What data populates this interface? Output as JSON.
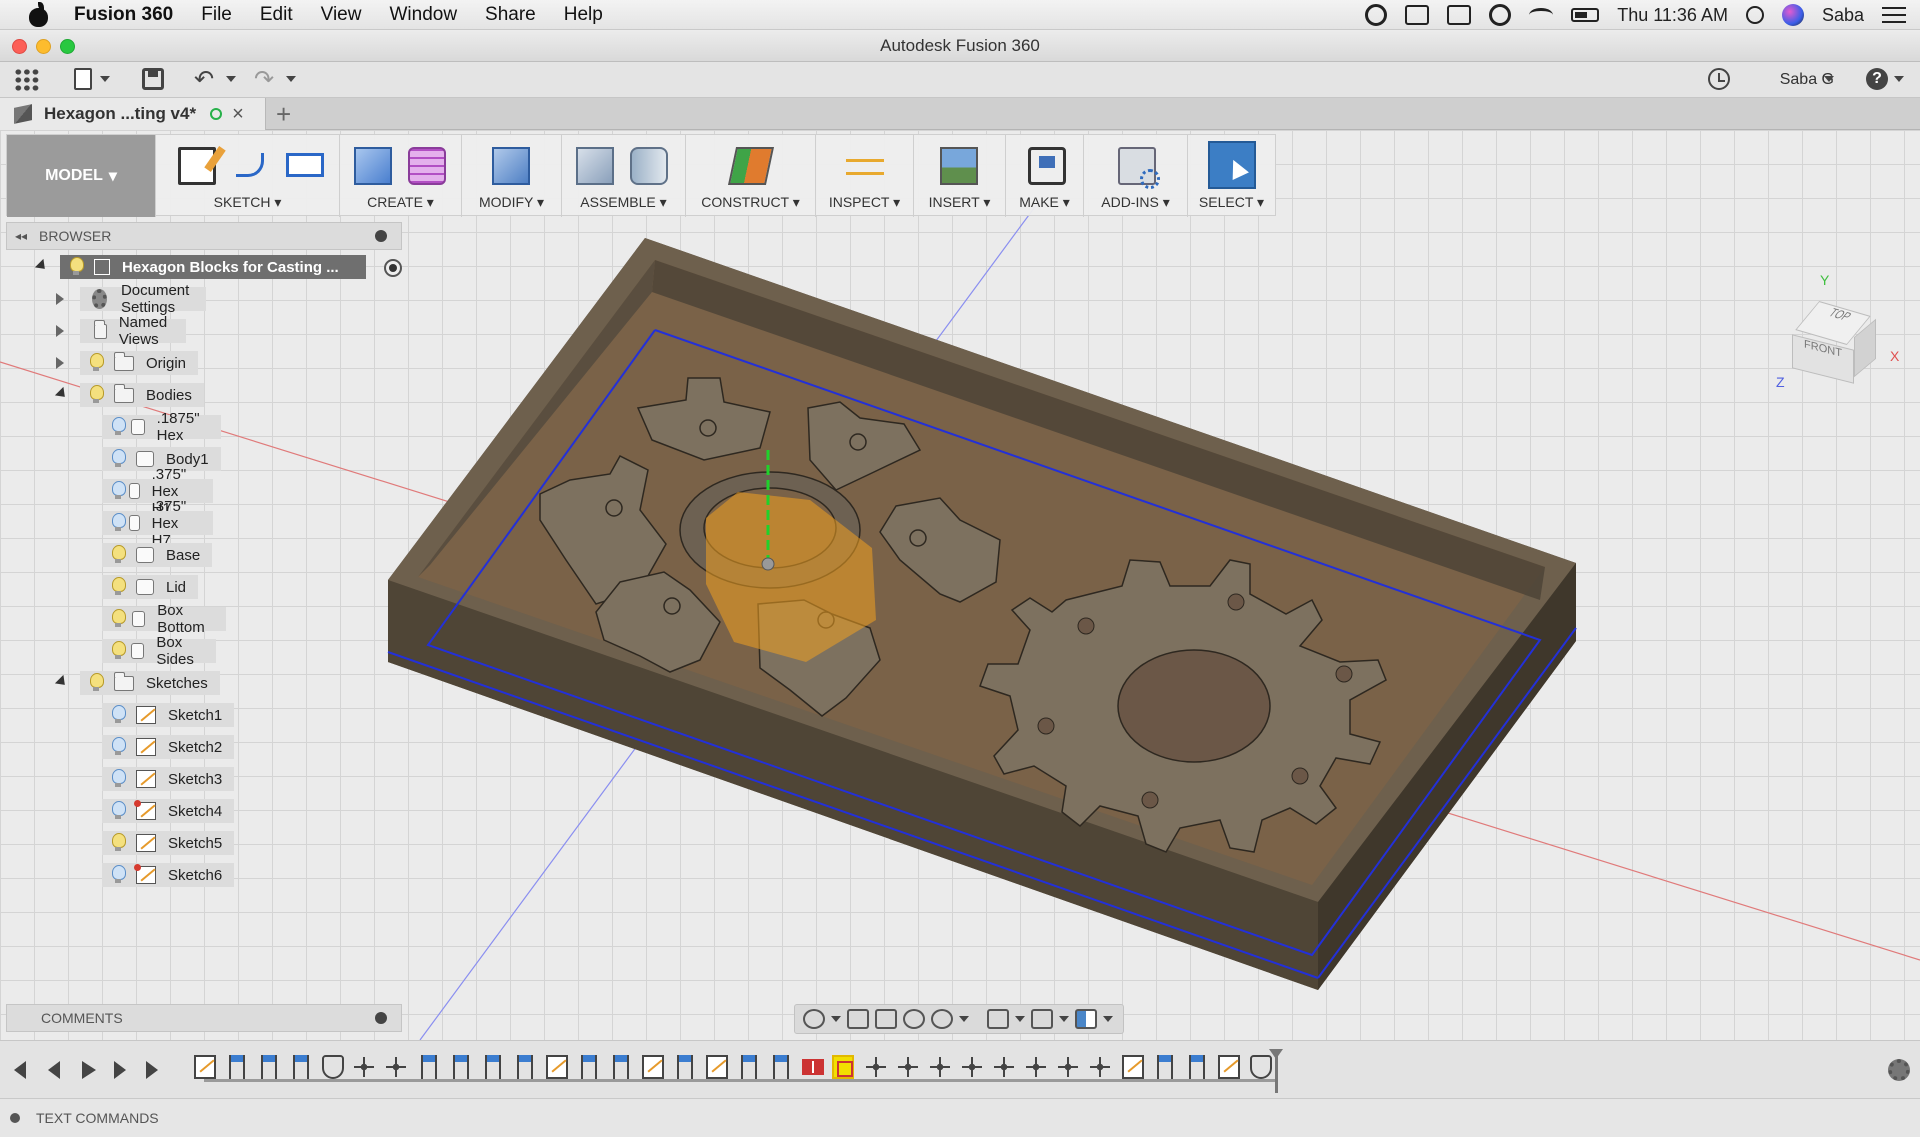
{
  "menubar": {
    "app": "Fusion 360",
    "menus": [
      "File",
      "Edit",
      "View",
      "Window",
      "Share",
      "Help"
    ],
    "clock": "Thu 11:36 AM",
    "user": "Saba",
    "status_icons": [
      "creative-cloud-icon",
      "adobe-icon",
      "airplay-icon",
      "time-machine-icon",
      "wifi-icon",
      "battery-icon",
      "spotlight-icon",
      "siri-icon",
      "notification-center-icon"
    ]
  },
  "window": {
    "title": "Autodesk Fusion 360"
  },
  "app_toolbar": {
    "user": "Saba G"
  },
  "document_tab": {
    "name": "Hexagon ...ting v4*"
  },
  "ribbon": {
    "workspace": "MODEL",
    "groups": [
      {
        "label": "SKETCH"
      },
      {
        "label": "CREATE"
      },
      {
        "label": "MODIFY"
      },
      {
        "label": "ASSEMBLE"
      },
      {
        "label": "CONSTRUCT"
      },
      {
        "label": "INSPECT"
      },
      {
        "label": "INSERT"
      },
      {
        "label": "MAKE"
      },
      {
        "label": "ADD-INS"
      },
      {
        "label": "SELECT"
      }
    ]
  },
  "browser": {
    "title": "BROWSER",
    "root": "Hexagon Blocks for Casting ...",
    "items": [
      {
        "label": "Document Settings"
      },
      {
        "label": "Named Views"
      },
      {
        "label": "Origin"
      },
      {
        "label": "Bodies"
      },
      {
        "label": ".1875\" Hex"
      },
      {
        "label": "Body1"
      },
      {
        "label": ".375\" Hex H1"
      },
      {
        "label": ".375\" Hex H7"
      },
      {
        "label": "Base"
      },
      {
        "label": "Lid"
      },
      {
        "label": "Box Bottom"
      },
      {
        "label": "Box Sides"
      },
      {
        "label": "Sketches"
      },
      {
        "label": "Sketch1"
      },
      {
        "label": "Sketch2"
      },
      {
        "label": "Sketch3"
      },
      {
        "label": "Sketch4"
      },
      {
        "label": "Sketch5"
      },
      {
        "label": "Sketch6"
      }
    ]
  },
  "viewcube": {
    "top": "TOP",
    "front": "FRONT",
    "axis_x": "X",
    "axis_y": "Y",
    "axis_z": "Z"
  },
  "comments": {
    "title": "COMMENTS"
  },
  "text_commands": {
    "title": "TEXT COMMANDS"
  },
  "colors": {
    "accent": "#3c7ec5",
    "model_body": "#6b5a47",
    "grid": "#d4d4d4",
    "axis_red": "#e06a6a",
    "axis_blue": "#8a8ef0",
    "highlight": "#f2df00"
  }
}
